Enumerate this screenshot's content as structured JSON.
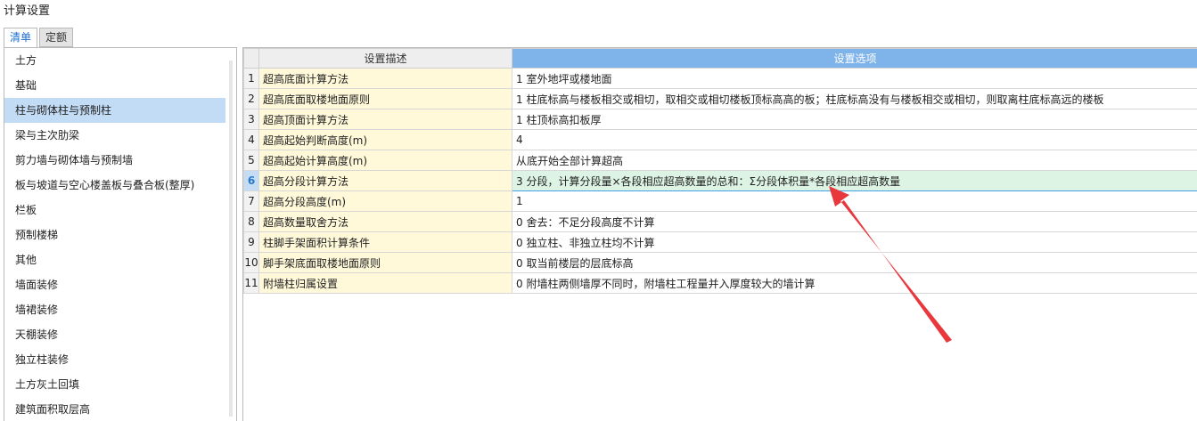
{
  "window": {
    "title": "计算设置"
  },
  "tabs": [
    {
      "label": "清单",
      "active": true
    },
    {
      "label": "定额",
      "active": false
    }
  ],
  "sidebar": {
    "selected_index": 2,
    "items": [
      {
        "label": "土方"
      },
      {
        "label": "基础"
      },
      {
        "label": "柱与砌体柱与预制柱"
      },
      {
        "label": "梁与主次肋梁"
      },
      {
        "label": "剪力墙与砌体墙与预制墙"
      },
      {
        "label": "板与坡道与空心楼盖板与叠合板(整厚)"
      },
      {
        "label": "栏板"
      },
      {
        "label": "预制楼梯"
      },
      {
        "label": "其他"
      },
      {
        "label": "墙面装修"
      },
      {
        "label": "墙裙装修"
      },
      {
        "label": "天棚装修"
      },
      {
        "label": "独立柱装修"
      },
      {
        "label": "土方灰土回填"
      },
      {
        "label": "建筑面积取层高"
      }
    ]
  },
  "grid": {
    "headers": {
      "desc": "设置描述",
      "option": "设置选项"
    },
    "selected_row": 6,
    "rows": [
      {
        "num": "1",
        "desc": "超高底面计算方法",
        "option": "1 室外地坪或楼地面"
      },
      {
        "num": "2",
        "desc": "超高底面取楼地面原则",
        "option": "1 柱底标高与楼板相交或相切，取相交或相切楼板顶标高高的板；柱底标高没有与楼板相交或相切，则取离柱底标高远的楼板"
      },
      {
        "num": "3",
        "desc": "超高顶面计算方法",
        "option": "1 柱顶标高扣板厚"
      },
      {
        "num": "4",
        "desc": "超高起始判断高度(m)",
        "option": "4"
      },
      {
        "num": "5",
        "desc": "超高起始计算高度(m)",
        "option": "从底开始全部计算超高"
      },
      {
        "num": "6",
        "desc": "超高分段计算方法",
        "option": "3 分段，计算分段量×各段相应超高数量的总和：Σ分段体积量*各段相应超高数量"
      },
      {
        "num": "7",
        "desc": "超高分段高度(m)",
        "option": "1"
      },
      {
        "num": "8",
        "desc": "超高数量取舍方法",
        "option": "0 舍去：不足分段高度不计算"
      },
      {
        "num": "9",
        "desc": "柱脚手架面积计算条件",
        "option": "0 独立柱、非独立柱均不计算"
      },
      {
        "num": "10",
        "desc": "脚手架底面取楼地面原则",
        "option": "0 取当前楼层的层底标高"
      },
      {
        "num": "11",
        "desc": "附墙柱归属设置",
        "option": "0 附墙柱两侧墙厚不同时，附墙柱工程量并入厚度较大的墙计算"
      }
    ]
  },
  "annotation": {
    "color": "#e8383d"
  }
}
